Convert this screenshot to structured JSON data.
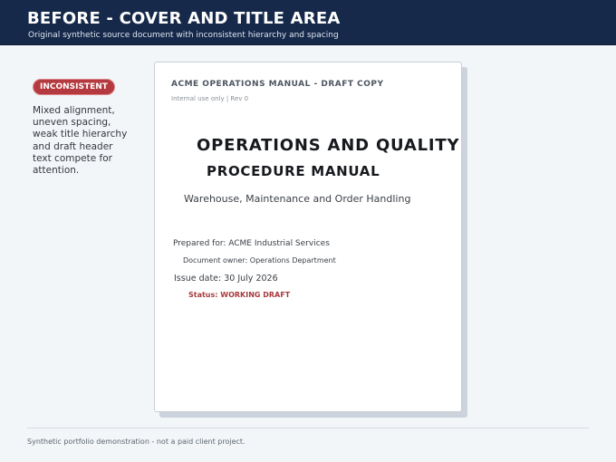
{
  "header": {
    "title": "BEFORE - COVER AND TITLE AREA",
    "subtitle": "Original synthetic source document with inconsistent hierarchy and spacing"
  },
  "sidebar": {
    "badge": "INCONSISTENT",
    "note": "Mixed alignment, uneven spacing, weak title hierarchy and draft header text compete for attention."
  },
  "document": {
    "draft_header": "ACME OPERATIONS MANUAL - DRAFT COPY",
    "meta": "Internal use only | Rev 0",
    "title_line1": "OPERATIONS AND QUALITY",
    "title_line2": "PROCEDURE MANUAL",
    "subtitle": "Warehouse, Maintenance and Order Handling",
    "prepared_for": "Prepared for: ACME Industrial Services",
    "document_owner": "Document owner: Operations Department",
    "issue_date": "Issue date: 30 July 2026",
    "status": "Status: WORKING DRAFT"
  },
  "footer": {
    "text": "Synthetic portfolio demonstration - not a paid client project."
  },
  "colors": {
    "header_bg": "#16294a",
    "badge_bg": "#b53a3f",
    "status_text": "#a83a3d",
    "background": "#f3f6f9"
  }
}
